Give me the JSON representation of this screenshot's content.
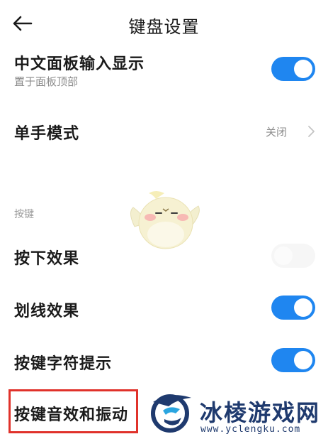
{
  "header": {
    "back_icon": "arrow-left-icon",
    "title": "键盘设置"
  },
  "settings": {
    "chinese_panel": {
      "label": "中文面板输入显示",
      "sublabel": "置于面板顶部",
      "enabled": true
    },
    "one_hand": {
      "label": "单手模式",
      "value": "关闭",
      "icon": "chevron-right-icon"
    },
    "section_keys": "按键",
    "press_effect": {
      "label": "按下效果",
      "enabled": false
    },
    "swipe_effect": {
      "label": "划线效果",
      "enabled": true
    },
    "key_hint": {
      "label": "按键字符提示",
      "enabled": true
    },
    "sound_vibration": {
      "label": "按键音效和振动"
    }
  },
  "watermark": {
    "name": "冰棱游戏网",
    "url": "www.yclengku.com"
  },
  "colors": {
    "accent": "#1f86f0",
    "highlight_border": "#e0322b",
    "watermark": "#1f3a6e"
  }
}
